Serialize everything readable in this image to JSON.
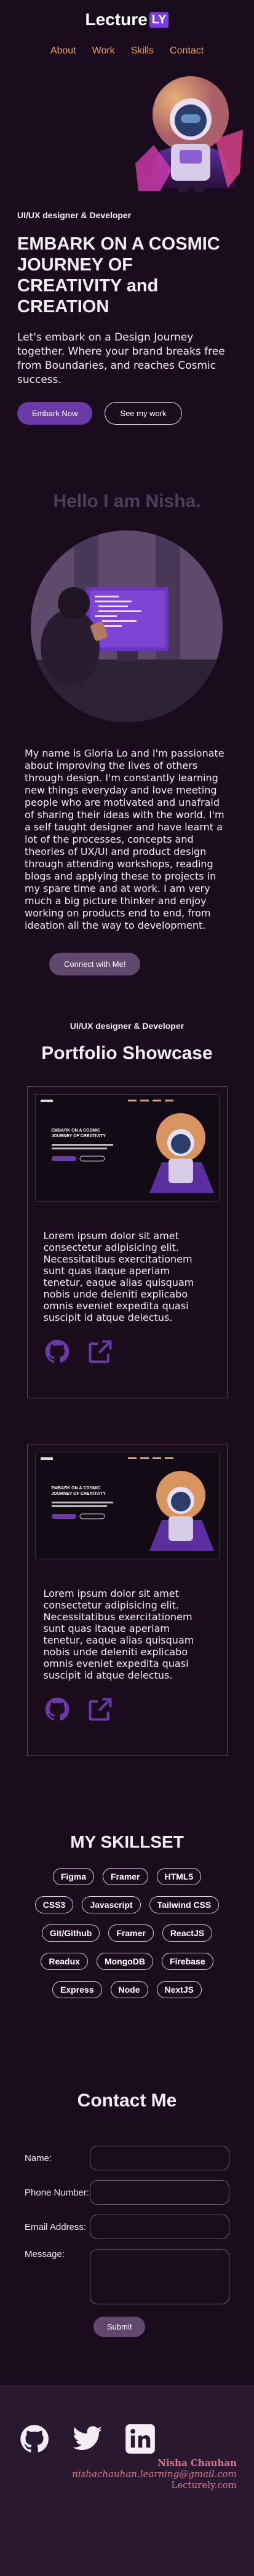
{
  "logo": {
    "text": "Lecture",
    "box": "LY"
  },
  "nav": {
    "links": [
      "About",
      "Work",
      "Skills",
      "Contact"
    ]
  },
  "hero": {
    "role": "UI/UX designer & Developer",
    "title": "EMBARK ON A COSMIC JOURNEY OF CREATIVITY and CREATION",
    "subtitle": "Let's embark on a Design Journey together. Where your brand breaks free from Boundaries, and reaches Cosmic success.",
    "primary_btn": "Embark Now",
    "secondary_btn": "See my work"
  },
  "about": {
    "hello": "Hello I am Nisha.",
    "text": "My name is Gloria Lo and I'm passionate about improving the lives of others through design. I'm constantly learning new things everyday and love meeting people who are motivated and unafraid of sharing their ideas with the world. I'm a self taught designer and have learnt a lot of the processes, concepts and theories of UX/UI and product design through attending workshops, reading blogs and applying these to projects in my spare time and at work. I am very much a big picture thinker and enjoy working on products end to end, from ideation all the way to development.",
    "button": "Connect with Me!"
  },
  "portfolio": {
    "role": "UI/UX designer & Developer",
    "title": "Portfolio Showcase",
    "cards": [
      {
        "shot_title": "EMBARK ON A COSMIC JOURNEY OF CREATIVITY",
        "text": "Lorem ipsum dolor sit amet consectetur adipisicing elit. Necessitatibus exercitationem sunt quas itaque aperiam tenetur, eaque alias quisquam nobis unde deleniti explicabo omnis eveniet expedita quasi suscipit id atque delectus."
      },
      {
        "shot_title": "EMBARK ON A COSMIC JOURNEY OF CREATIVITY",
        "text": "Lorem ipsum dolor sit amet consectetur adipisicing elit. Necessitatibus exercitationem sunt quas itaque aperiam tenetur, eaque alias quisquam nobis unde deleniti explicabo omnis eveniet expedita quasi suscipit id atque delectus."
      }
    ],
    "icons": [
      "github-icon",
      "external-link-icon"
    ]
  },
  "skills": {
    "title": "MY SKILLSET",
    "items": [
      "Figma",
      "Framer",
      "HTML5",
      "CSS3",
      "Javascript",
      "Tailwind CSS",
      "Git/Github",
      "Framer",
      "ReactJS",
      "Readux",
      "MongoDB",
      "Firebase",
      "Express",
      "Node",
      "NextJS"
    ]
  },
  "contact": {
    "title": "Contact Me",
    "name_label": "Name:",
    "phone_label": "Phone Number:",
    "email_label": "Email Address:",
    "message_label": "Message:",
    "submit": "Submit"
  },
  "footer": {
    "icons": [
      "github-icon",
      "twitter-icon",
      "linkedin-icon"
    ],
    "name": "Nisha Chauhan",
    "email": "nishachauhan.learning@gmail.com",
    "site": "Lecturely.com"
  },
  "colors": {
    "background": "#1a0c1c",
    "accent": "#6a3aa6",
    "nav_link": "#e8a06e",
    "footer": "#2a1830",
    "footer_text": "#d77a86"
  }
}
